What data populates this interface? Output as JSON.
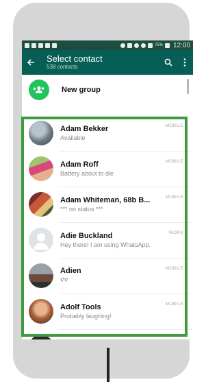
{
  "status_bar": {
    "time": "12:00",
    "battery": "75%"
  },
  "header": {
    "title": "Select contact",
    "subtitle": "538 contacts",
    "icons": [
      "back-arrow-icon",
      "search-icon",
      "more-vert-icon"
    ]
  },
  "new_group": {
    "label": "New group",
    "icon": "group-add-icon"
  },
  "contacts": [
    {
      "name": "Adam Bekker",
      "status": "Available",
      "type": "MOBILE"
    },
    {
      "name": "Adam Roff",
      "status": "Battery about to die",
      "type": "MOBILE"
    },
    {
      "name": "Adam Whiteman, 68b B...",
      "status": "*** no status ***",
      "type": "MOBILE"
    },
    {
      "name": "Adie Buckland",
      "status": "Hey there! I am using WhatsApp.",
      "type": "WORK"
    },
    {
      "name": "Adien",
      "status": "ኛኛ",
      "type": "MOBILE"
    },
    {
      "name": "Adolf Tools",
      "status": "Probably laughing!",
      "type": "MOBILE"
    }
  ],
  "colors": {
    "toolbar": "#075e54",
    "status_bar": "#1d4d40",
    "accent": "#22c35e",
    "highlight": "#3c9b3c"
  }
}
